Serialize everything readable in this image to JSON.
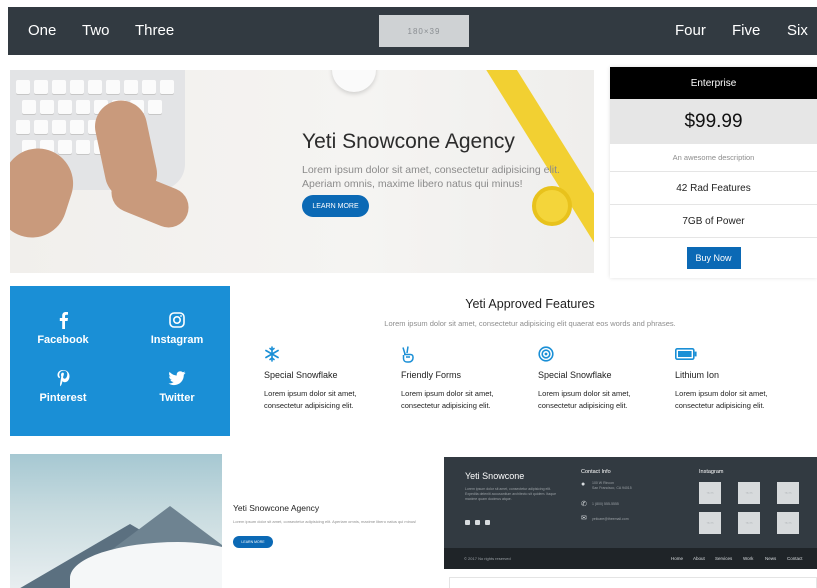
{
  "nav": {
    "left_links": [
      "One",
      "Two",
      "Three"
    ],
    "right_links": [
      "Four",
      "Five",
      "Six"
    ],
    "logo_placeholder": "180×39"
  },
  "hero": {
    "title": "Yeti Snowcone Agency",
    "text": "Lorem ipsum dolor sit amet, consectetur adipisicing elit. Aperiam omnis, maxime libero natus qui minus!",
    "button": "LEARN MORE"
  },
  "pricing": {
    "plan": "Enterprise",
    "price": "$99.99",
    "description": "An awesome description",
    "features": [
      "42 Rad Features",
      "7GB of Power"
    ],
    "button": "Buy Now"
  },
  "social": [
    {
      "label": "Facebook",
      "icon": "facebook-icon"
    },
    {
      "label": "Instagram",
      "icon": "instagram-icon"
    },
    {
      "label": "Pinterest",
      "icon": "pinterest-icon"
    },
    {
      "label": "Twitter",
      "icon": "twitter-icon"
    }
  ],
  "features": {
    "title": "Yeti Approved Features",
    "subtitle": "Lorem ipsum dolor sit amet, consectetur adipisicing elit quaerat eos words and phrases.",
    "items": [
      {
        "name": "Special Snowflake",
        "desc": "Lorem ipsum dolor sit amet, consectetur adipisicing elit.",
        "icon": "snowflake-icon"
      },
      {
        "name": "Friendly Forms",
        "desc": "Lorem ipsum dolor sit amet, consectetur adipisicing elit.",
        "icon": "peace-hand-icon"
      },
      {
        "name": "Special Snowflake",
        "desc": "Lorem ipsum dolor sit amet, consectetur adipisicing elit.",
        "icon": "target-icon"
      },
      {
        "name": "Lithium Ion",
        "desc": "Lorem ipsum dolor sit amet, consectetur adipisicing elit.",
        "icon": "battery-icon"
      }
    ]
  },
  "media": {
    "title": "Yeti Snowcone Agency",
    "text": "Lorem ipsum dolor sit amet, consectetur adipisicing elit. Aperiam omnis, maxime libero natus qui minus!",
    "button": "LEARN MORE"
  },
  "footer": {
    "name": "Yeti Snowcone",
    "text": "Lorem ipsum dolor sit amet, consectetur adipisicing elit. Expedita deleniti accusantium architecto sit quidem. Itaque maxime quam ducimus atque.",
    "contact_heading": "Contact Info",
    "address_1": "100 W Rincon",
    "address_2": "San Francisco, CA 94015",
    "phone": "1 (800) 555-5555",
    "email": "yeticare@theemail.com",
    "instagram_heading": "Instagram",
    "thumb_label": "75×75",
    "copyright": "© 2017 No rights reserved",
    "links": [
      "Home",
      "About",
      "Services",
      "Work",
      "News",
      "Contact"
    ]
  },
  "colors": {
    "nav_bg": "#323a41",
    "accent_blue": "#0b69b5",
    "social_blue": "#1a8fd6"
  }
}
